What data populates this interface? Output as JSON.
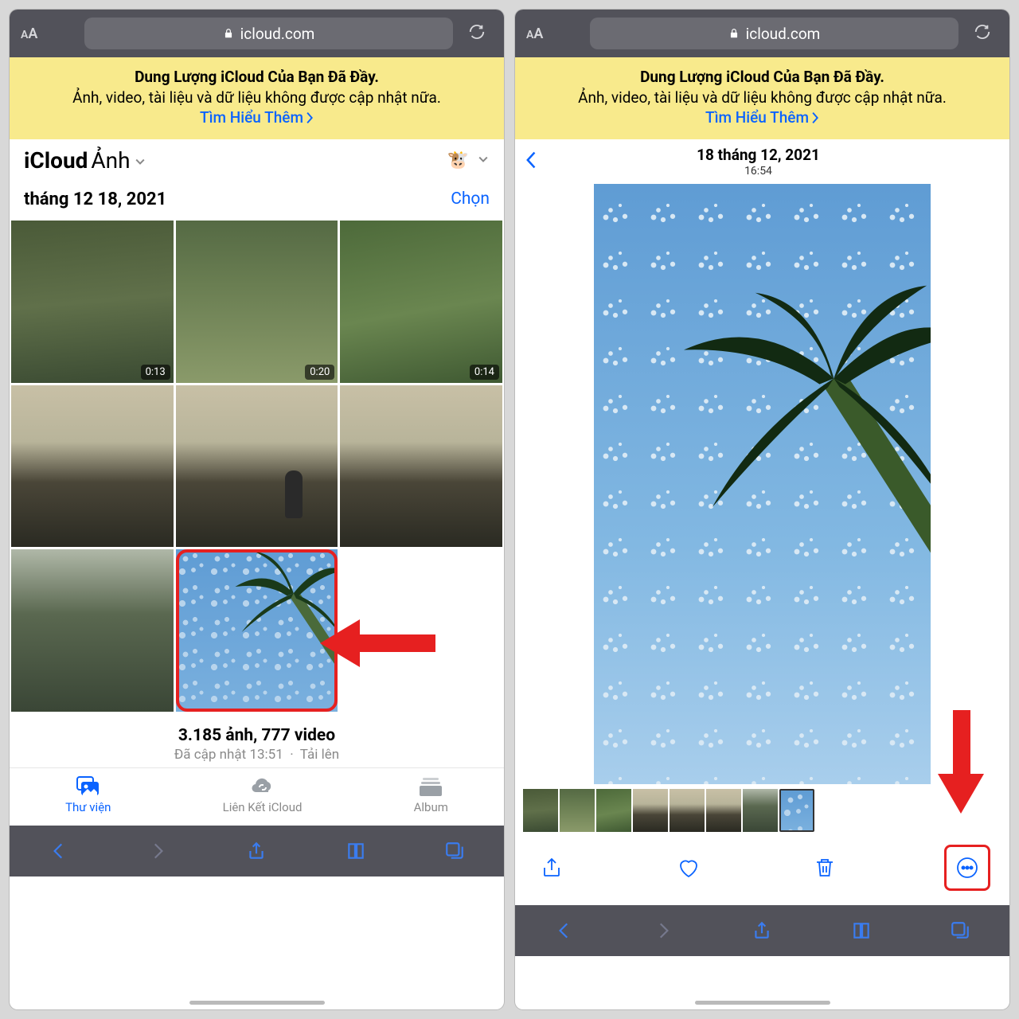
{
  "url": "icloud.com",
  "banner": {
    "title": "Dung Lượng iCloud Của Bạn Đã Đầy.",
    "body": "Ảnh, video, tài liệu và dữ liệu không được cập nhật nữa.",
    "link": "Tìm Hiểu Thêm"
  },
  "left": {
    "app_title_prefix": "iCloud",
    "app_title_main": "Ảnh",
    "avatar_emoji": "🐮",
    "date_heading": "tháng 12 18, 2021",
    "select_label": "Chọn",
    "thumbs": [
      {
        "kind": "grass",
        "badge": "0:13"
      },
      {
        "kind": "canal",
        "badge": "0:20"
      },
      {
        "kind": "green",
        "badge": "0:14"
      },
      {
        "kind": "sunset",
        "badge": null
      },
      {
        "kind": "sunset-person",
        "badge": null
      },
      {
        "kind": "sunset",
        "badge": null
      },
      {
        "kind": "lake",
        "badge": null
      },
      {
        "kind": "sky",
        "badge": null,
        "selected": true
      },
      {
        "kind": "empty",
        "badge": null
      }
    ],
    "counts_line1": "3.185 ảnh, 777 video",
    "counts_line2a": "Đã cập nhật 13:51",
    "counts_line2b": "Tải lên",
    "tabs": [
      {
        "label": "Thư viện",
        "active": true
      },
      {
        "label": "Liên Kết iCloud",
        "active": false
      },
      {
        "label": "Album",
        "active": false
      }
    ]
  },
  "right": {
    "date_line": "18 tháng 12, 2021",
    "time_line": "16:54",
    "filmstrip": [
      "grass",
      "canal",
      "green",
      "sunset",
      "sunset",
      "sunset",
      "lake",
      "sky"
    ]
  },
  "colors": {
    "accent": "#0a63ff",
    "danger": "#e62020",
    "banner": "#f8ea8c"
  }
}
